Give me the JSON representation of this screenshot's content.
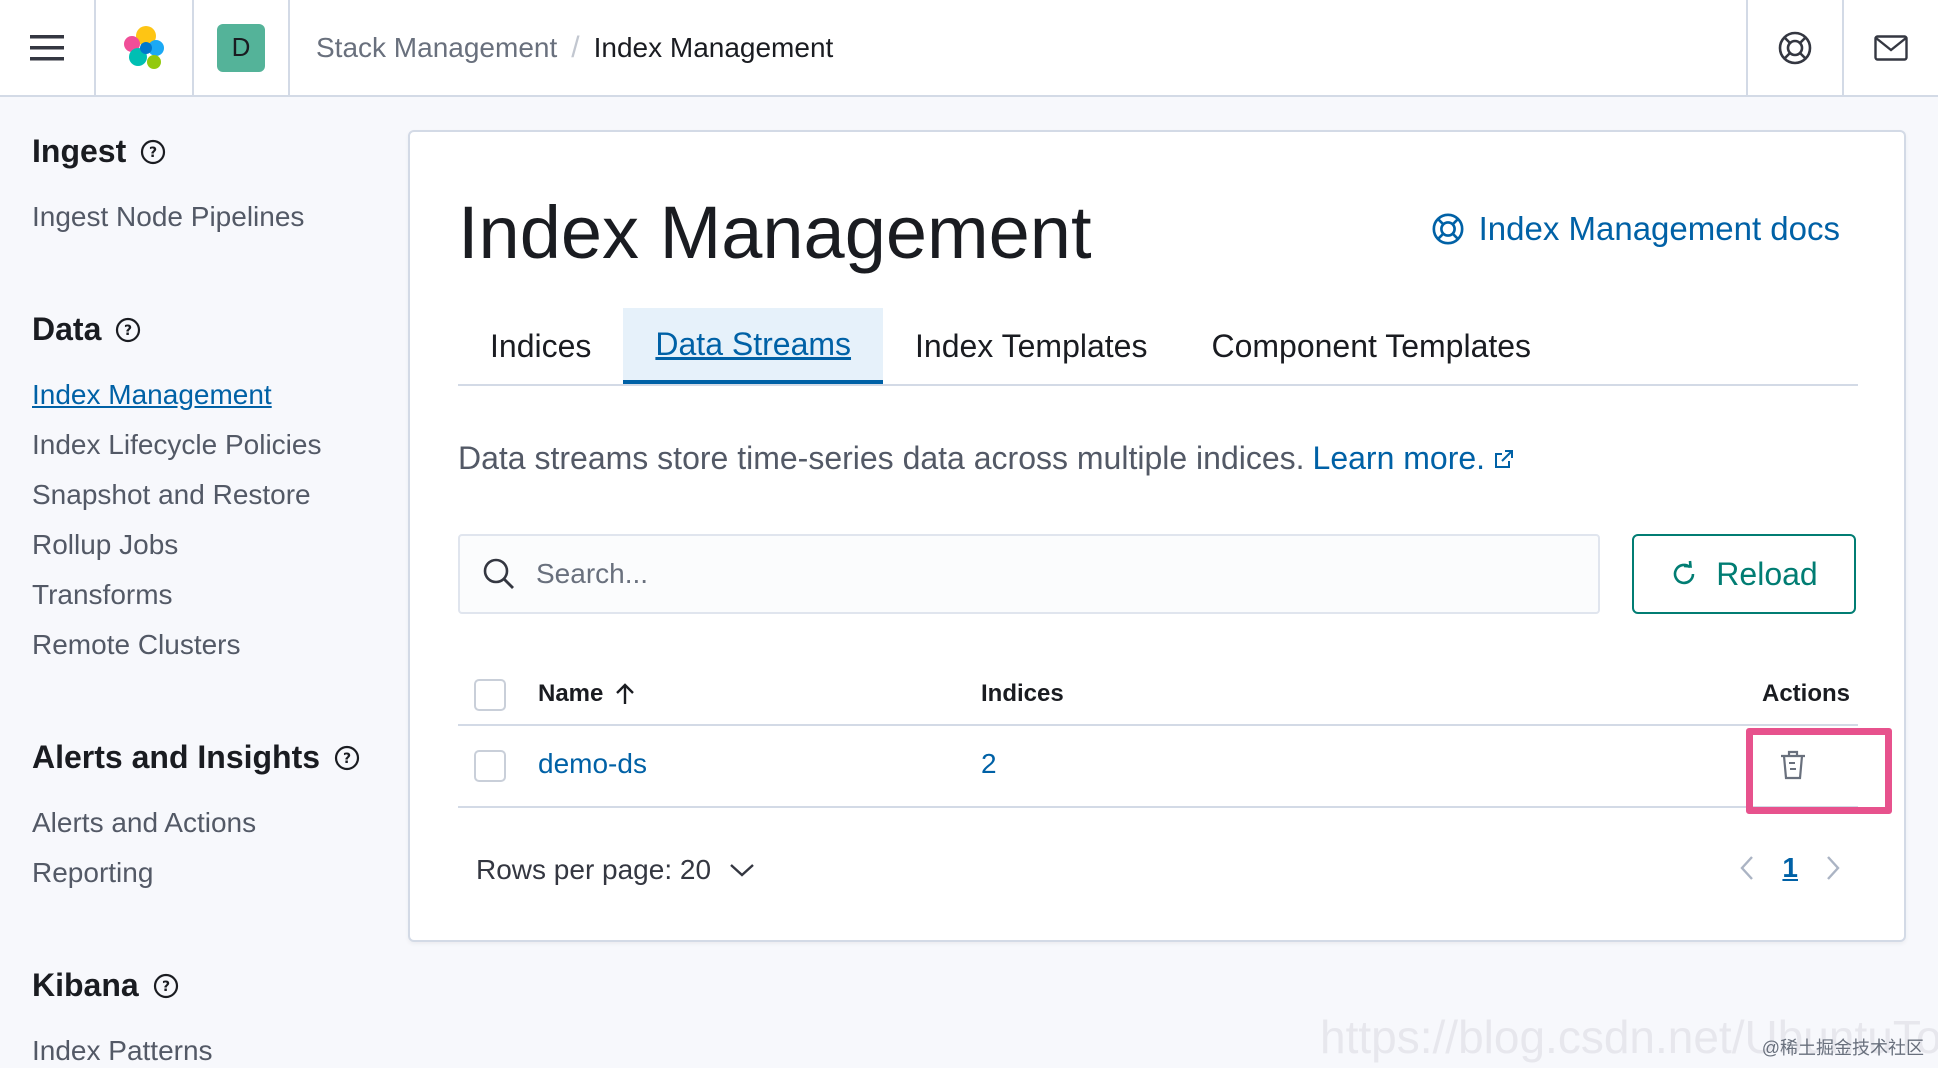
{
  "header": {
    "space_initial": "D",
    "breadcrumbs": [
      "Stack Management",
      "Index Management"
    ],
    "separator": "/",
    "icons": [
      "menu-icon",
      "elastic-logo-icon",
      "help-lifebuoy-icon",
      "mail-icon"
    ]
  },
  "sidebar": {
    "groups": [
      {
        "title": "Ingest",
        "items": [
          "Ingest Node Pipelines"
        ]
      },
      {
        "title": "Data",
        "items": [
          "Index Management",
          "Index Lifecycle Policies",
          "Snapshot and Restore",
          "Rollup Jobs",
          "Transforms",
          "Remote Clusters"
        ]
      },
      {
        "title": "Alerts and Insights",
        "items": [
          "Alerts and Actions",
          "Reporting"
        ]
      },
      {
        "title": "Kibana",
        "items": [
          "Index Patterns"
        ]
      }
    ],
    "active_item": "Index Management"
  },
  "main": {
    "title": "Index Management",
    "docs_link": "Index Management docs",
    "tabs": [
      {
        "label": "Indices",
        "active": false
      },
      {
        "label": "Data Streams",
        "active": true
      },
      {
        "label": "Index Templates",
        "active": false
      },
      {
        "label": "Component Templates",
        "active": false
      }
    ],
    "description": "Data streams store time-series data across multiple indices.",
    "learn_more": "Learn more.",
    "search": {
      "placeholder": "Search...",
      "value": ""
    },
    "reload_label": "Reload",
    "table": {
      "columns": [
        "Name",
        "Indices",
        "Actions"
      ],
      "rows": [
        {
          "name": "demo-ds",
          "indices": "2"
        }
      ]
    },
    "pagination": {
      "rows_per_page_label": "Rows per page: 20",
      "current_page": "1"
    }
  },
  "watermark": "@稀土掘金技术社区",
  "watermark_url": "https://blog.csdn.net/UbuntuTouch",
  "colors": {
    "accent": "#0061a6",
    "reload": "#017d73",
    "highlight": "#e7528d",
    "space_avatar": "#54b399"
  }
}
